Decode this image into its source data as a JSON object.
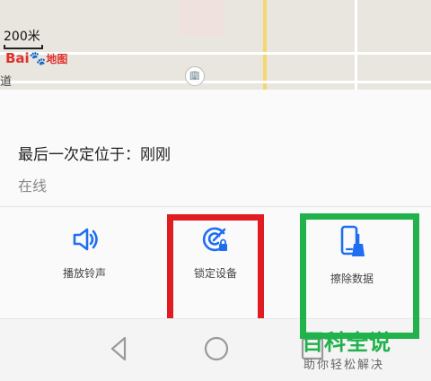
{
  "map": {
    "scale_label": "200米",
    "brand_text": "Bai",
    "brand_cn": "地图",
    "left_edge_text": "道"
  },
  "device": {
    "last_location_label": "最后一次定位于：刚刚",
    "status": "在线"
  },
  "actions": [
    {
      "label": "播放铃声",
      "icon": "speaker-icon"
    },
    {
      "label": "锁定设备",
      "icon": "lock-device-icon"
    },
    {
      "label": "擦除数据",
      "icon": "erase-phone-icon"
    }
  ],
  "navbar": {
    "buttons": [
      "back-icon",
      "home-icon",
      "recents-icon"
    ]
  },
  "watermark": {
    "main": "百科全说",
    "sub": "助你轻松解决"
  },
  "colors": {
    "accent": "#1f6ef2",
    "highlight_red": "#e01b22",
    "highlight_green": "#21b24c"
  }
}
